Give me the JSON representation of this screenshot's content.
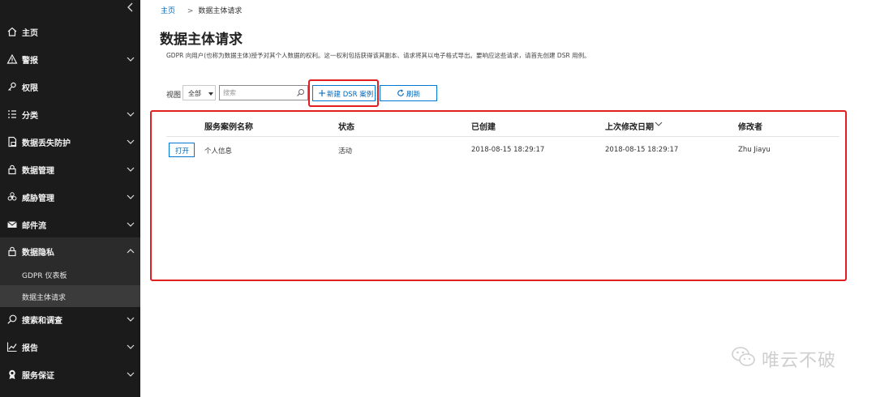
{
  "sidebar": {
    "items": [
      {
        "label": "主页",
        "icon": "home-icon"
      },
      {
        "label": "警报",
        "icon": "warning-icon"
      },
      {
        "label": "权限",
        "icon": "permissions-icon"
      },
      {
        "label": "分类",
        "icon": "classification-icon"
      },
      {
        "label": "数据丢失防护",
        "icon": "dlp-icon"
      },
      {
        "label": "数据管理",
        "icon": "lock-icon"
      },
      {
        "label": "威胁管理",
        "icon": "biohazard-icon"
      },
      {
        "label": "邮件流",
        "icon": "mail-icon"
      },
      {
        "label": "数据隐私",
        "icon": "lock-icon"
      },
      {
        "label": "搜索和调查",
        "icon": "search-icon"
      },
      {
        "label": "报告",
        "icon": "chart-icon"
      },
      {
        "label": "服务保证",
        "icon": "ribbon-icon"
      }
    ],
    "subitems": [
      {
        "label": "GDPR 仪表板"
      },
      {
        "label": "数据主体请求"
      }
    ]
  },
  "breadcrumb": {
    "home": "主页",
    "separator": ">",
    "current": "数据主体请求"
  },
  "page": {
    "title": "数据主体请求",
    "description": "GDPR 向用户(也称为数据主体)授予对其个人数据的权利。这一权利包括获得该其副本、请求将其以电子格式导出。要响应这些请求，请首先创建 DSR 用例。"
  },
  "toolbar": {
    "view_label": "视图",
    "view_value": "全部",
    "search_placeholder": "搜索",
    "new_label": "新建 DSR 案例",
    "refresh_label": "刷新"
  },
  "table": {
    "columns": [
      "服务案例名称",
      "状态",
      "已创建",
      "上次修改日期",
      "修改者"
    ],
    "rows": [
      {
        "action": "打开",
        "name": "个人信息",
        "status": "活动",
        "created": "2018-08-15 18:29:17",
        "modified": "2018-08-15 18:29:17",
        "modified_by": "Zhu Jiayu"
      }
    ]
  },
  "watermark": {
    "text": "唯云不破"
  },
  "colors": {
    "sidebar_bg": "#1b1b1b",
    "accent": "#0078d4",
    "highlight": "#e02020"
  }
}
